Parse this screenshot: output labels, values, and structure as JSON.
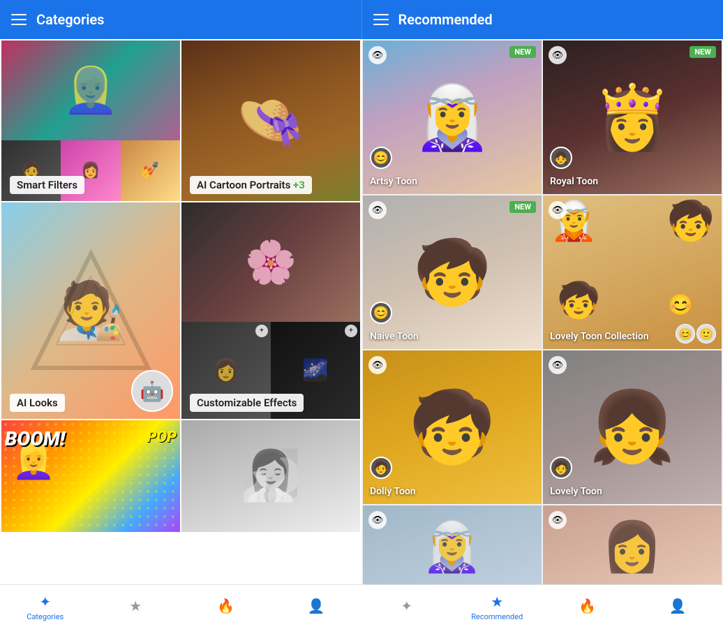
{
  "left_header": {
    "title": "Categories",
    "menu_icon": "hamburger"
  },
  "right_header": {
    "title": "Recommended",
    "menu_icon": "hamburger"
  },
  "categories": [
    {
      "id": "smart-filters",
      "label": "Smart Filters",
      "plus_count": null
    },
    {
      "id": "ai-cartoon",
      "label": "AI Cartoon Portraits",
      "plus_count": "+3"
    },
    {
      "id": "ai-looks",
      "label": "AI Looks",
      "plus_count": null
    },
    {
      "id": "customizable",
      "label": "Customizable Effects",
      "plus_count": null
    },
    {
      "id": "comic",
      "label": "",
      "plus_count": null
    },
    {
      "id": "silhouette",
      "label": "",
      "plus_count": null
    }
  ],
  "recommended": [
    {
      "id": "artsy-toon",
      "label": "Artsy Toon",
      "is_new": true,
      "has_eye_icon": true
    },
    {
      "id": "royal-toon",
      "label": "Royal Toon",
      "is_new": true,
      "has_eye_icon": true
    },
    {
      "id": "naive-toon",
      "label": "Naive Toon",
      "is_new": true,
      "has_eye_icon": true
    },
    {
      "id": "lovely-toon-collection",
      "label": "Lovely Toon Collection",
      "is_new": false,
      "has_eye_icon": true
    },
    {
      "id": "dolly-toon",
      "label": "Dolly Toon",
      "is_new": false,
      "has_eye_icon": true
    },
    {
      "id": "lovely-toon",
      "label": "Lovely Toon",
      "is_new": false,
      "has_eye_icon": true
    },
    {
      "id": "item7",
      "label": "",
      "is_new": false,
      "has_eye_icon": true
    },
    {
      "id": "item8",
      "label": "",
      "is_new": false,
      "has_eye_icon": true
    }
  ],
  "bottom_nav_left": {
    "items": [
      {
        "id": "categories",
        "label": "Categories",
        "icon": "✦",
        "active": true
      },
      {
        "id": "favorites",
        "label": "",
        "icon": "★",
        "active": false
      },
      {
        "id": "trending",
        "label": "",
        "icon": "🔥",
        "active": false
      },
      {
        "id": "profile-left",
        "label": "",
        "icon": "👤",
        "active": false
      }
    ]
  },
  "bottom_nav_right": {
    "items": [
      {
        "id": "magic",
        "label": "",
        "icon": "✦",
        "active": false
      },
      {
        "id": "recommended-nav",
        "label": "Recommended",
        "icon": "★",
        "active": true
      },
      {
        "id": "trending2",
        "label": "",
        "icon": "🔥",
        "active": false
      },
      {
        "id": "profile-right",
        "label": "",
        "icon": "👤",
        "active": false
      }
    ]
  },
  "badge": {
    "new_text": "NEW"
  }
}
